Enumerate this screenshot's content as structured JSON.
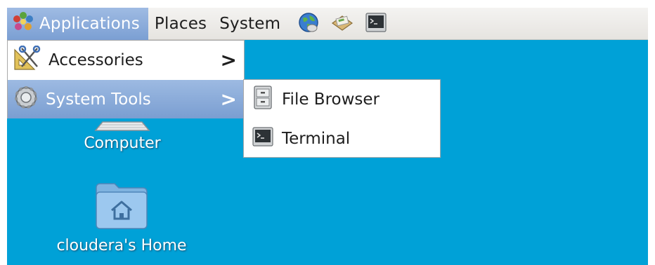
{
  "panel": {
    "menus": [
      {
        "label": "Applications",
        "icon": "gnome-foot-icon"
      },
      {
        "label": "Places"
      },
      {
        "label": "System"
      }
    ],
    "launchers": [
      "web-browser-icon",
      "mail-icon",
      "terminal-icon"
    ]
  },
  "applications_menu": {
    "items": [
      {
        "label": "Accessories",
        "icon": "accessories-icon",
        "has_submenu": true
      },
      {
        "label": "System Tools",
        "icon": "gear-icon",
        "has_submenu": true,
        "highlighted": true
      }
    ],
    "submenu_arrow": ">"
  },
  "system_tools_submenu": {
    "items": [
      {
        "label": "File Browser",
        "icon": "file-cabinet-icon"
      },
      {
        "label": "Terminal",
        "icon": "terminal-icon"
      }
    ]
  },
  "desktop": {
    "icons": [
      {
        "label": "Computer",
        "icon": "computer-icon"
      },
      {
        "label": "cloudera's Home",
        "icon": "home-folder-icon"
      }
    ]
  },
  "colors": {
    "desktop": "#00a1d7",
    "highlight": "#8aaadb",
    "panel": "#ecebe8"
  }
}
